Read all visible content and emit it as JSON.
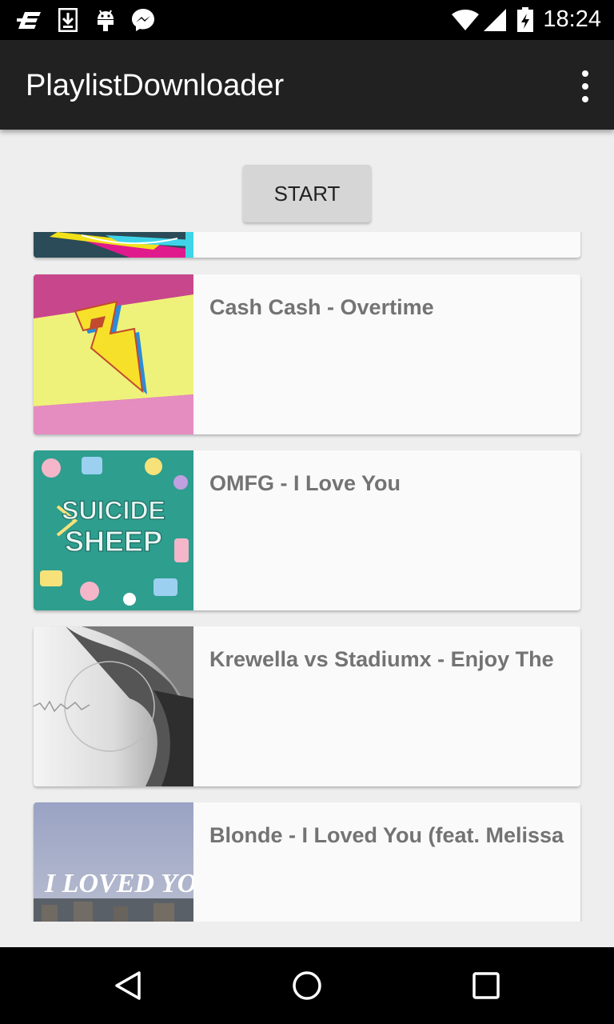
{
  "status_bar": {
    "time": "18:24",
    "icons": [
      "e-icon",
      "download-icon",
      "android-icon",
      "messenger-icon",
      "wifi-icon",
      "signal-icon",
      "battery-charging-icon"
    ]
  },
  "app_bar": {
    "title": "PlaylistDownloader",
    "menu_icon": "overflow-menu-icon"
  },
  "start_button": {
    "label": "START"
  },
  "playlist": {
    "items": [
      {
        "title": ""
      },
      {
        "title": "Cash Cash - Overtime"
      },
      {
        "title": "OMFG - I Love You"
      },
      {
        "title": "Krewella vs Stadiumx - Enjoy The"
      },
      {
        "title": "Blonde - I Loved You (feat. Melissa"
      }
    ]
  },
  "thumbnails": {
    "omfg_text_1": "SUICIDE",
    "omfg_text_2": "SHEEP",
    "blonde_text": "I LOVED YOU"
  },
  "nav_bar": {
    "icons": [
      "back-icon",
      "home-icon",
      "recents-icon"
    ]
  }
}
